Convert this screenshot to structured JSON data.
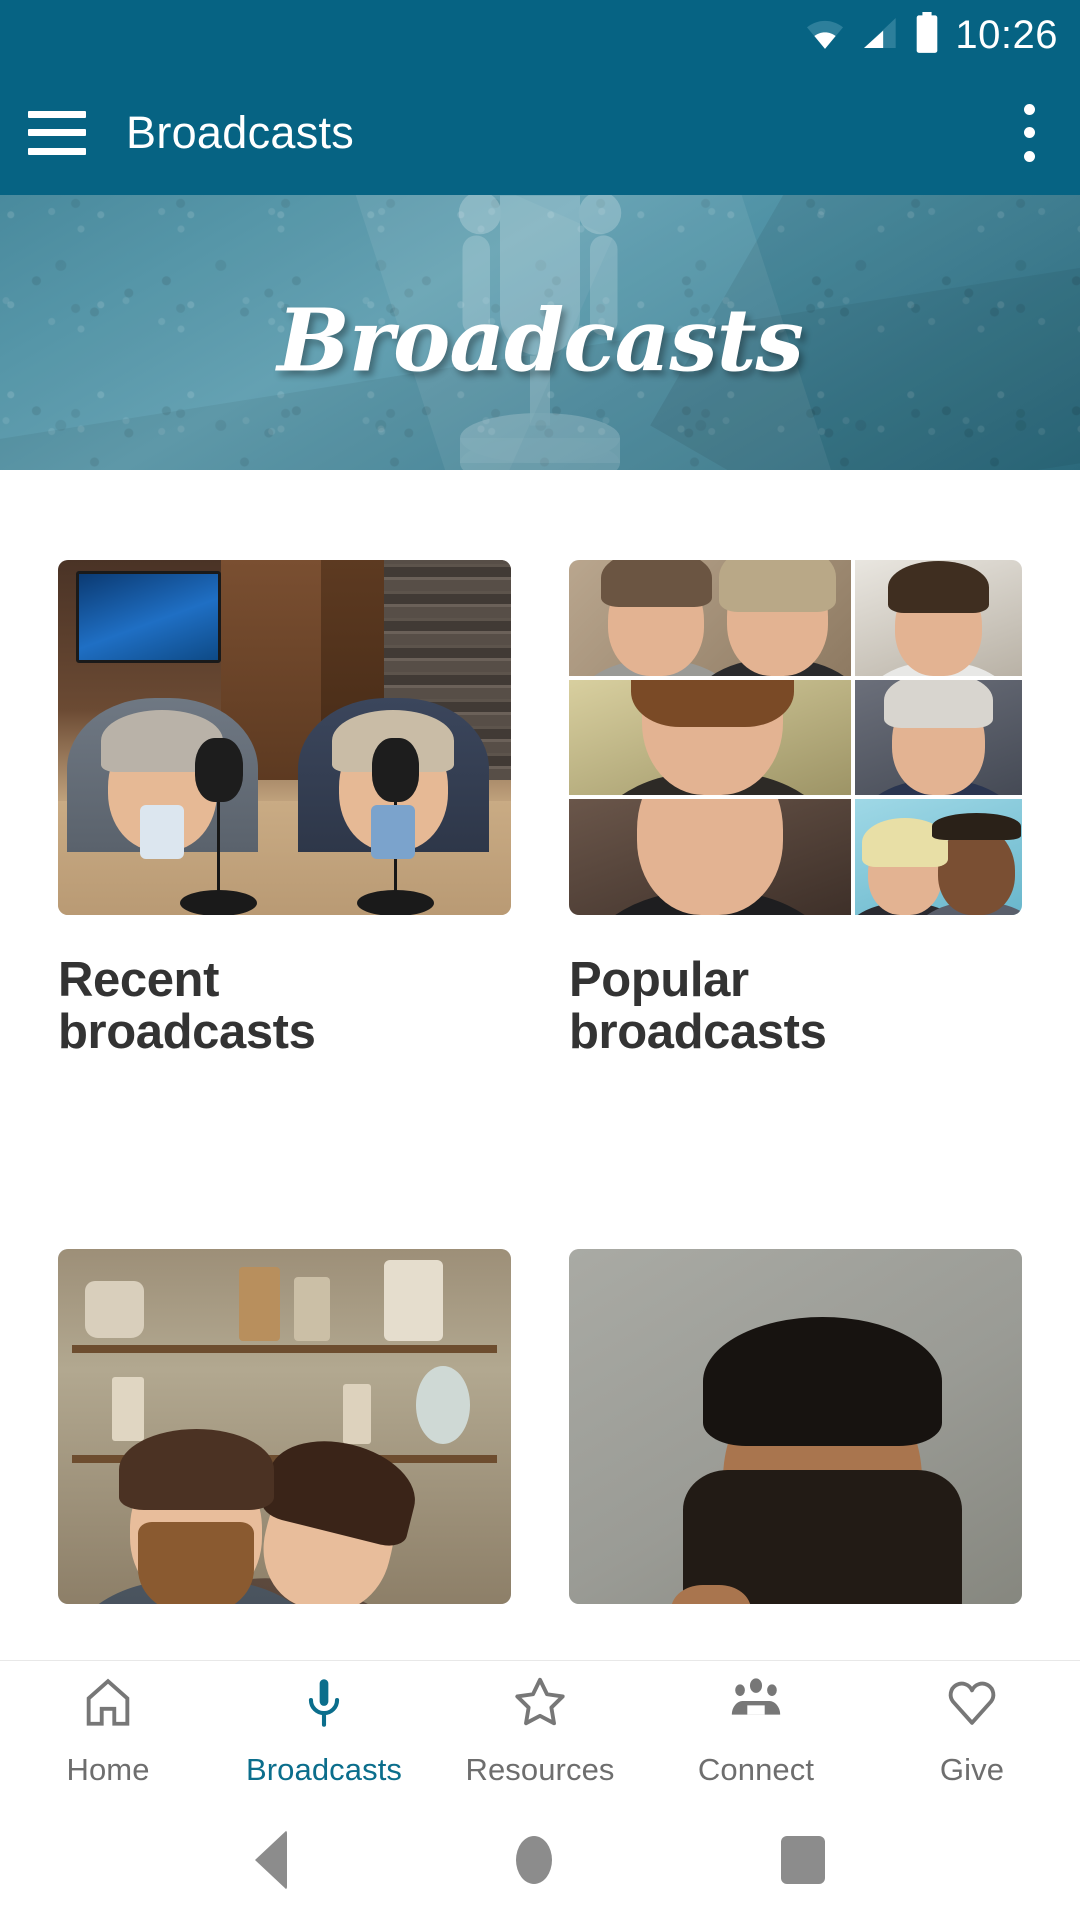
{
  "status_bar": {
    "time": "10:26",
    "icons": [
      "wifi-icon",
      "cellular-signal-icon",
      "battery-icon"
    ]
  },
  "app_bar": {
    "menu_icon": "hamburger-menu-icon",
    "title": "Broadcasts",
    "overflow_icon": "more-options-icon"
  },
  "hero": {
    "title": "Broadcasts",
    "background_icon": "microphone-icon",
    "background_color": "#4a8da1"
  },
  "colors": {
    "header_teal": "#066383",
    "accent_teal": "#0b6e8c",
    "hero_teal": "#4a8da1",
    "title_text": "#333333",
    "nav_inactive": "#6e6e6e"
  },
  "cards": [
    {
      "title": "Recent\nbroadcasts",
      "image": "studio-hosts-photo"
    },
    {
      "title": "Popular\nbroadcasts",
      "image": "speakers-collage-photo"
    },
    {
      "title": "",
      "image": "laughing-couple-photo"
    },
    {
      "title": "",
      "image": "bearded-man-portrait-photo"
    }
  ],
  "bottom_nav": {
    "active_index": 1,
    "items": [
      {
        "label": "Home",
        "icon": "home-icon"
      },
      {
        "label": "Broadcasts",
        "icon": "microphone-icon"
      },
      {
        "label": "Resources",
        "icon": "star-icon"
      },
      {
        "label": "Connect",
        "icon": "people-group-icon"
      },
      {
        "label": "Give",
        "icon": "heart-icon"
      }
    ]
  },
  "system_nav": {
    "items": [
      {
        "name": "back-button",
        "icon": "triangle-back-icon"
      },
      {
        "name": "home-button",
        "icon": "circle-home-icon"
      },
      {
        "name": "recents-button",
        "icon": "square-recents-icon"
      }
    ]
  }
}
